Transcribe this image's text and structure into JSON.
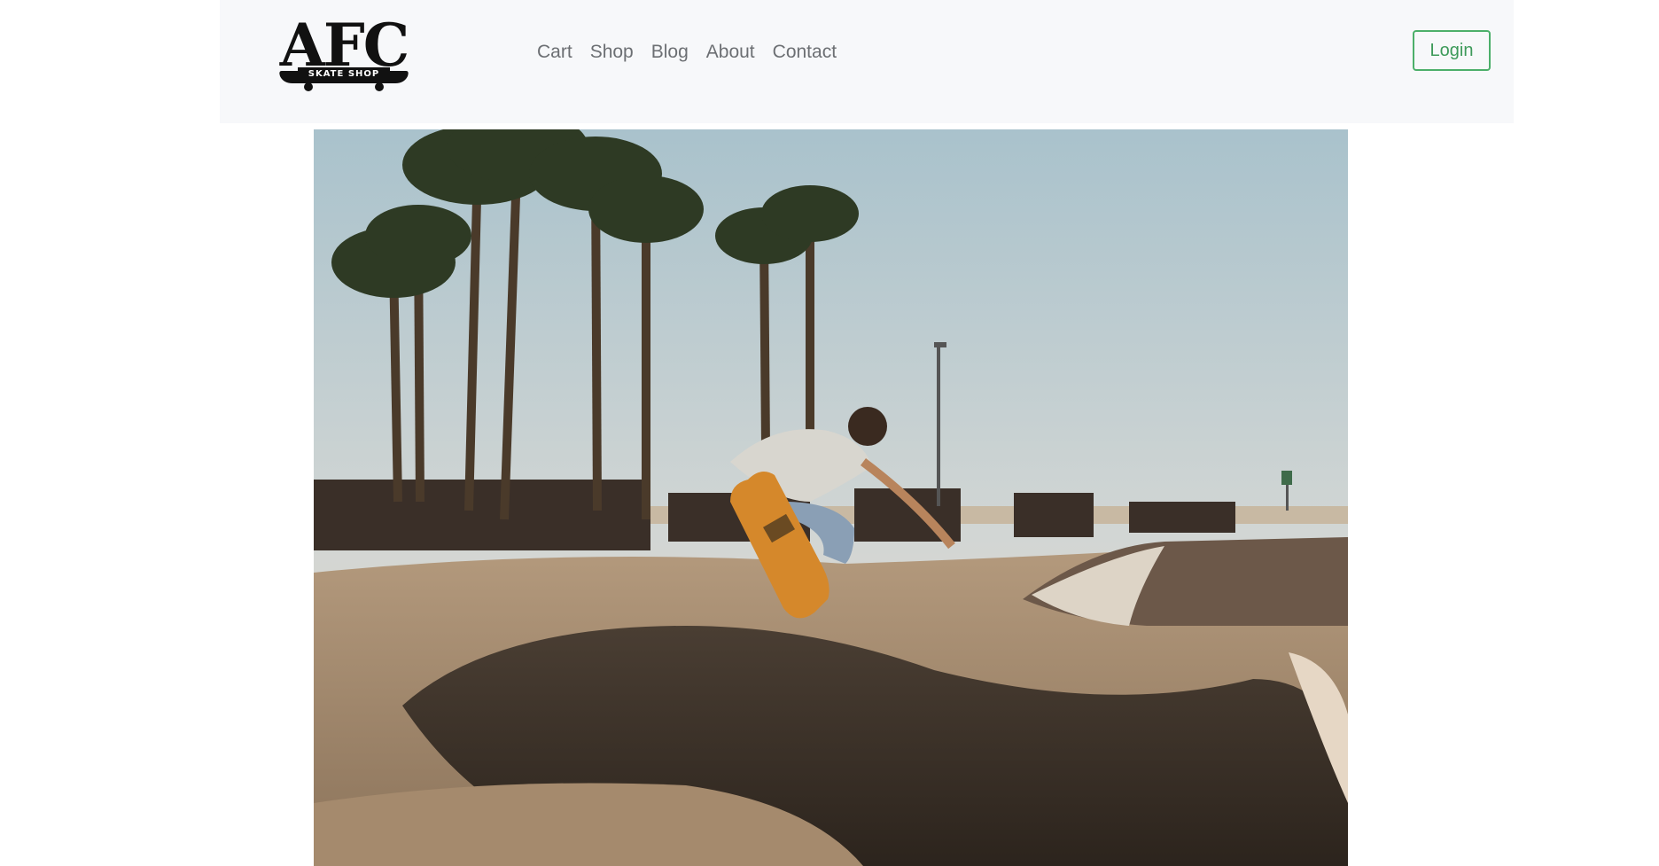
{
  "navbar": {
    "brand": {
      "logo_text": "AFC",
      "logo_subtext": "SKATE SHOP"
    },
    "links": [
      {
        "label": "Cart"
      },
      {
        "label": "Shop"
      },
      {
        "label": "Blog"
      },
      {
        "label": "About"
      },
      {
        "label": "Contact"
      }
    ],
    "login_label": "Login"
  },
  "hero": {
    "image": "skatepark-photo"
  },
  "colors": {
    "navbar_bg": "#f7f8fa",
    "nav_link": "#6c6f73",
    "login_accent": "#4caf6a"
  }
}
